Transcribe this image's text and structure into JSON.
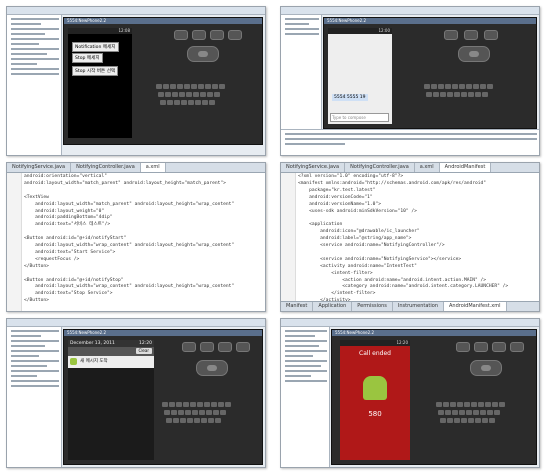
{
  "panels": {
    "p1": {
      "emulator_title": "5554:NewPhone2.2",
      "menu_items": [
        "Notification 메세지",
        "Stop 메세지",
        "Stop 시작 버튼 선택"
      ]
    },
    "p2": {
      "emulator_title": "5554:NewPhone2.2",
      "input_value": "5554 5555 19",
      "input_placeholder": "Type to compose"
    },
    "p3": {
      "tabs": [
        "NotifyingService.java",
        "NotifyingController.java",
        "a.xml"
      ],
      "code_lines": [
        "android:orientation=\"vertical\"",
        "android:layout_width=\"match_parent\" android:layout_height=\"match_parent\">",
        "",
        "<TextView",
        "    android:layout_width=\"match_parent\" android:layout_height=\"wrap_content\"",
        "    android:layout_weight=\"0\"",
        "    android:paddingBottom=\"4dip\"",
        "    android:text=\"서비스 테스트\"/>",
        "",
        "<Button android:id=\"@+id/notifyStart\"",
        "    android:layout_width=\"wrap_content\" android:layout_height=\"wrap_content\"",
        "    android:text=\"Start Service\">",
        "    <requestFocus />",
        "</Button>",
        "",
        "<Button android:id=\"@+id/notifyStop\"",
        "    android:layout_width=\"wrap_content\" android:layout_height=\"wrap_content\"",
        "    android:text=\"Stop Service\">",
        "</Button>",
        "",
        "</LinearLayout>"
      ]
    },
    "p4": {
      "tabs": [
        "NotifyingService.java",
        "NotifyingController.java",
        "a.xml",
        "AndroidManifest"
      ],
      "code_lines": [
        "<?xml version=\"1.0\" encoding=\"utf-8\"?>",
        "<manifest xmlns:android=\"http://schemas.android.com/apk/res/android\"",
        "    package=\"kr.test.latest\"",
        "    android:versionCode=\"1\"",
        "    android:versionName=\"1.0\">",
        "    <uses-sdk android:minSdkVersion=\"10\" />",
        "",
        "    <application",
        "        android:icon=\"@drawable/ic_launcher\"",
        "        android:label=\"@string/app_name\">",
        "        <service android:name=\"NotifyingController\"/>",
        "",
        "        <service android:name=\"NotifyingService\"></service>",
        "        <activity android:name=\"IntentTest\"",
        "            <intent-filter>",
        "                <action android:name=\"android.intent.action.MAIN\" />",
        "                <category android:name=\"android.intent.category.LAUNCHER\" />",
        "            </intent-filter>",
        "        </activity>",
        "    </application>",
        "</manifest>"
      ],
      "bottom_tabs": [
        "Manifest",
        "Application",
        "Permissions",
        "Instrumentation",
        "AndroidManifest.xml"
      ]
    },
    "p5": {
      "emulator_title": "5554:NewPhone2.2",
      "date": "December 13, 2011",
      "time": "12:20",
      "header": "Notifications",
      "clear_label": "Clear",
      "item": "새 메시지 도착"
    },
    "p6": {
      "emulator_title": "5554:NewPhone2.2",
      "time": "12:20",
      "call_text": "Call ended",
      "number": "580"
    }
  },
  "colors": {
    "selection": "#3c6bc4",
    "call_red": "#b01818",
    "android_green": "#9ac540"
  },
  "icons": [
    "folder-icon",
    "android-robot-icon",
    "dpad-icon",
    "home-icon",
    "back-icon"
  ]
}
